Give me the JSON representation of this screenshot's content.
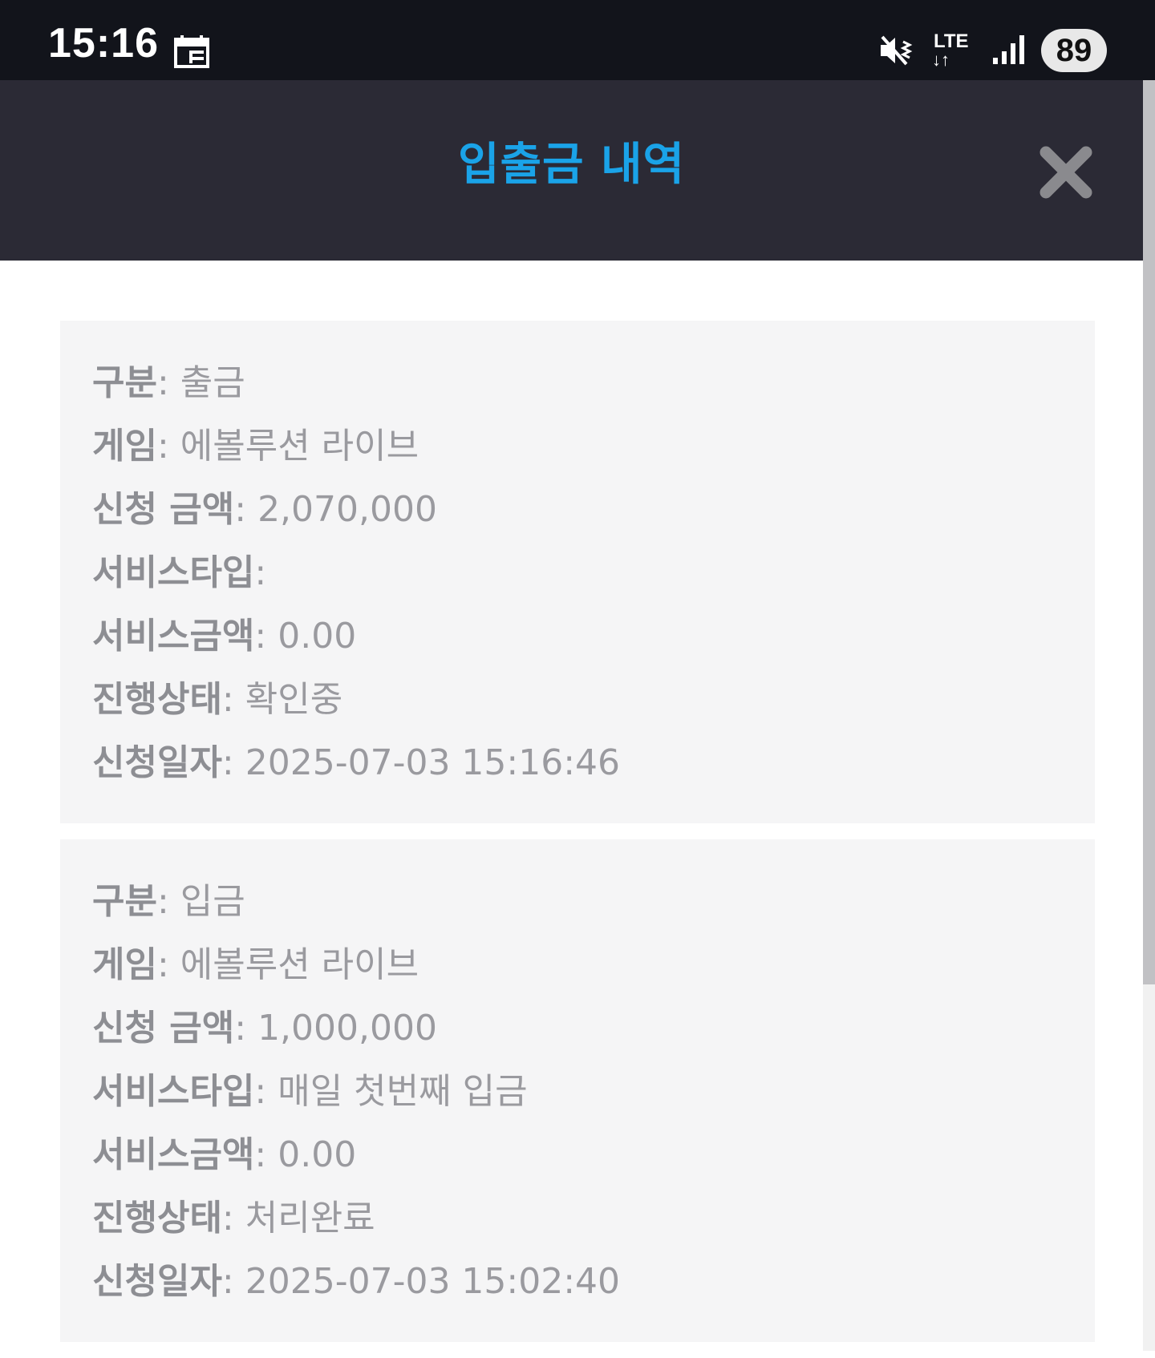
{
  "status_bar": {
    "time": "15:16",
    "network": "LTE",
    "network_arrows": "↓↑",
    "battery": "89"
  },
  "header": {
    "title": "입출금 내역",
    "title_color": "#1aa3e8",
    "close_icon": "close-icon"
  },
  "labels": {
    "type": "구분",
    "game": "게임",
    "amount": "신청 금액",
    "service_type": "서비스타입",
    "service_amount": "서비스금액",
    "status": "진행상태",
    "date": "신청일자",
    "separator": ": "
  },
  "transactions": [
    {
      "type": "출금",
      "game": "에볼루션 라이브",
      "amount": "2,070,000",
      "service_type": "",
      "service_amount": "0.00",
      "status": "확인중",
      "date": "2025-07-03 15:16:46"
    },
    {
      "type": "입금",
      "game": "에볼루션 라이브",
      "amount": "1,000,000",
      "service_type": "매일 첫번째 입금",
      "service_amount": "0.00",
      "status": "처리완료",
      "date": "2025-07-03 15:02:40"
    }
  ]
}
